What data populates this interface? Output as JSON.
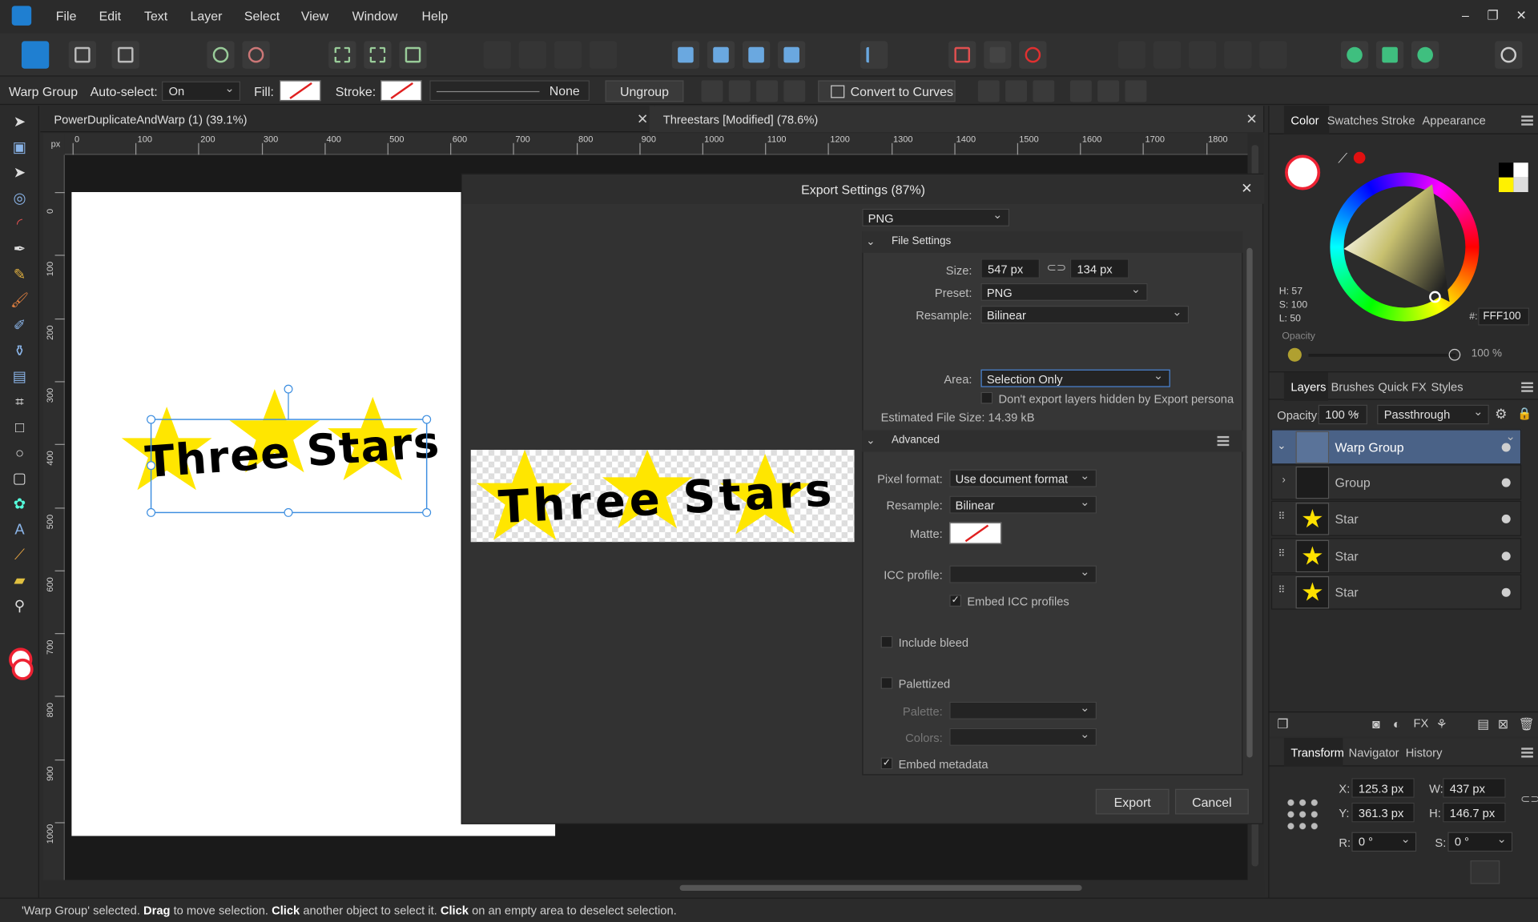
{
  "menu": [
    "File",
    "Edit",
    "Text",
    "Layer",
    "Select",
    "View",
    "Window",
    "Help"
  ],
  "context": {
    "selection_label": "Warp Group",
    "auto_select_label": "Auto-select:",
    "auto_select_value": "On",
    "fill_label": "Fill:",
    "stroke_label": "Stroke:",
    "stroke_style": "None",
    "ungroup": "Ungroup",
    "convert": "Convert to Curves"
  },
  "tabs": [
    {
      "label": "PowerDuplicateAndWarp (1) (39.1%)"
    },
    {
      "label": "Threestars [Modified] (78.6%)"
    }
  ],
  "ruler": {
    "unit": "px",
    "h_ticks": [
      "0",
      "100",
      "200",
      "300",
      "400",
      "500",
      "600",
      "700",
      "800",
      "900",
      "1000",
      "1100",
      "1200",
      "1300",
      "1400",
      "1500",
      "1600",
      "1700",
      "1800"
    ],
    "v_ticks": [
      "0",
      "100",
      "200",
      "300",
      "400",
      "500",
      "600",
      "700",
      "800",
      "900",
      "1000"
    ]
  },
  "artwork": {
    "text": "Three Stars"
  },
  "export": {
    "title": "Export Settings (87%)",
    "format": "PNG",
    "file_settings": "File Settings",
    "size_label": "Size:",
    "width": "547 px",
    "height": "134 px",
    "preset_label": "Preset:",
    "preset": "PNG",
    "resample_label": "Resample:",
    "resample": "Bilinear",
    "area_label": "Area:",
    "area": "Selection Only",
    "hidden_layers": "Don't export layers hidden by Export persona",
    "file_size": "Estimated File Size: 14.39 kB",
    "advanced": "Advanced",
    "pixel_format_label": "Pixel format:",
    "pixel_format": "Use document format",
    "resample2_label": "Resample:",
    "resample2": "Bilinear",
    "matte_label": "Matte:",
    "icc_label": "ICC profile:",
    "embed_icc": "Embed ICC profiles",
    "include_bleed": "Include bleed",
    "palettized": "Palettized",
    "palette_label": "Palette:",
    "colors_label": "Colors:",
    "embed_metadata": "Embed metadata",
    "export_btn": "Export",
    "cancel_btn": "Cancel"
  },
  "color_panel": {
    "tabs": [
      "Color",
      "Swatches",
      "Stroke",
      "Appearance"
    ],
    "h": "H: 57",
    "s": "S: 100",
    "l": "L: 50",
    "hex_label": "#:",
    "hex": "FFF100",
    "opacity_label": "Opacity",
    "opacity": "100 %",
    "accent": "#fff100"
  },
  "layers_panel": {
    "tabs": [
      "Layers",
      "Brushes",
      "Quick FX",
      "Styles"
    ],
    "opacity_label": "Opacity:",
    "opacity": "100 %",
    "blend": "Passthrough",
    "layers": [
      {
        "name": "Warp Group"
      },
      {
        "name": "Group"
      },
      {
        "name": "Star"
      },
      {
        "name": "Star"
      },
      {
        "name": "Star"
      }
    ]
  },
  "transform_panel": {
    "tabs": [
      "Transform",
      "Navigator",
      "History"
    ],
    "x_label": "X:",
    "x": "125.3 px",
    "w_label": "W:",
    "w": "437 px",
    "y_label": "Y:",
    "y": "361.3 px",
    "h_label": "H:",
    "h": "146.7 px",
    "r_label": "R:",
    "r": "0 °",
    "s_label": "S:",
    "s": "0 °"
  },
  "status": {
    "p1": "'Warp Group' selected. ",
    "b1": "Drag",
    "p2": " to move selection. ",
    "b2": "Click",
    "p3": " another object to select it. ",
    "b3": "Click",
    "p4": " on an empty area to deselect selection."
  }
}
